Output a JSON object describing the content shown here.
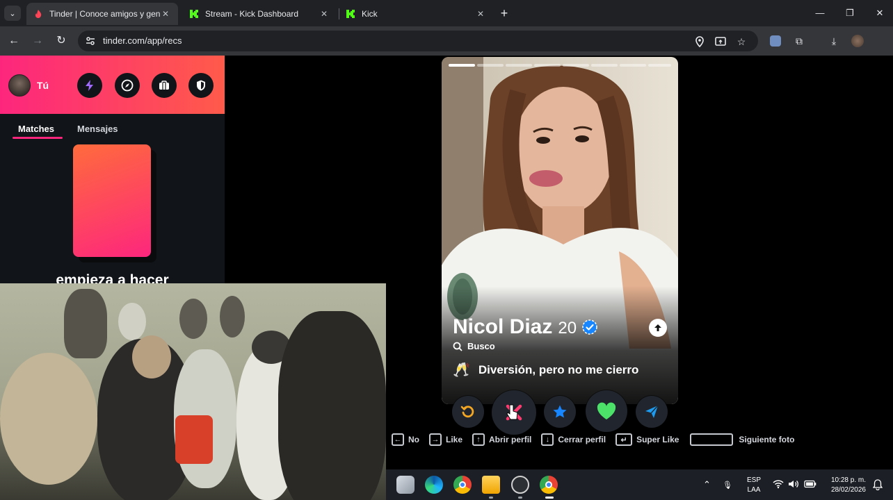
{
  "browser": {
    "tabs": [
      {
        "title": "Tinder | Conoce amigos y gente",
        "close": "✕",
        "active": true
      },
      {
        "title": "Stream - Kick Dashboard",
        "close": "✕",
        "active": false
      },
      {
        "title": "Kick",
        "close": "✕",
        "active": false
      }
    ],
    "new_tab": "+",
    "url": "tinder.com/app/recs",
    "window_controls": {
      "minimize": "—",
      "maximize": "❐",
      "close": "✕"
    }
  },
  "sidebar": {
    "user_label": "Tú",
    "header_icons": [
      "boost-icon",
      "explore-icon",
      "swipe-night-icon",
      "safety-shield-icon"
    ],
    "tabs": [
      {
        "label": "Matches",
        "active": true
      },
      {
        "label": "Mensajes",
        "active": false
      }
    ],
    "promo_text": "empieza a hacer"
  },
  "profile": {
    "name": "Nicol Diaz",
    "age": "20",
    "verified": true,
    "looking_for_label": "Busco",
    "intent_emoji": "🥂",
    "intent": "Diversión, pero no me cierro",
    "photo_count": 8,
    "photo_index": 0
  },
  "actions": [
    {
      "name": "rewind-button",
      "icon": "rewind-icon",
      "color": "#f5a623"
    },
    {
      "name": "nope-button",
      "icon": "nope-icon",
      "color": "#fe3c72"
    },
    {
      "name": "super-like-button",
      "icon": "star-icon",
      "color": "#1786ff"
    },
    {
      "name": "like-button",
      "icon": "heart-icon",
      "color": "#21e786"
    },
    {
      "name": "boost-button",
      "icon": "send-icon",
      "color": "#1d9bf0"
    }
  ],
  "hints": {
    "no": "No",
    "like": "Like",
    "open_profile": "Abrir perfil",
    "close_profile": "Cerrar perfil",
    "super_like": "Super Like",
    "next_photo": "Siguiente foto"
  },
  "taskbar": {
    "lang_top": "ESP",
    "lang_bottom": "LAA",
    "time": "10:28 p. m.",
    "date": "28/02/2026"
  },
  "colors": {
    "tinder_gradient_start": "#fd267d",
    "tinder_gradient_end": "#ff5a4a",
    "kick_green": "#53fc18"
  }
}
